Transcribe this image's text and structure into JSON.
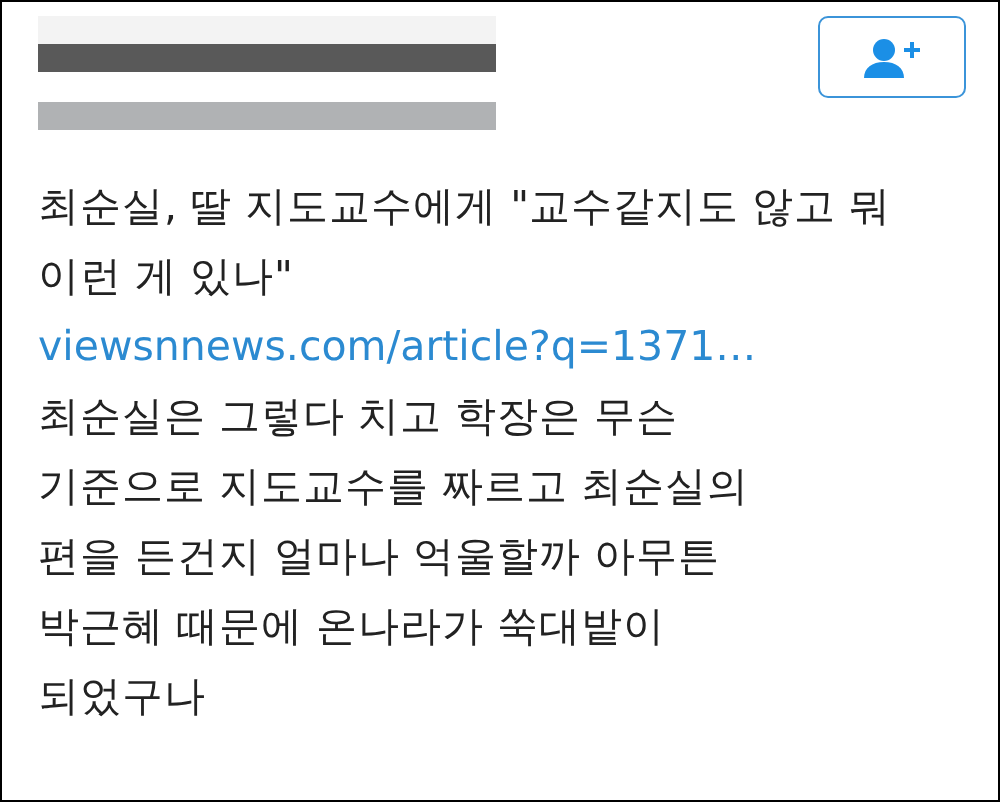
{
  "follow_button": {
    "kind": "follow"
  },
  "tweet": {
    "headline": "최순실, 딸 지도교수에게 \"교수같지도 않고 뭐 이런 게 있나\"",
    "link": "viewsnnews.com/article?q=1371…",
    "body": "최순실은 그렇다 치고 학장은 무슨 기준으로 지도교수를 짜르고 최순실의 편을 든건지 얼마나 억울할까 아무튼 박근혜 때문에 온나라가 쑥대밭이 되었구나"
  }
}
